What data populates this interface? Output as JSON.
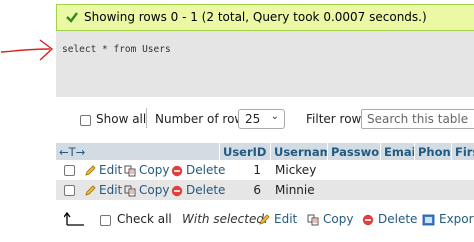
{
  "banner": {
    "message": "Showing rows 0 - 1 (2 total, Query took 0.0007 seconds.)",
    "icon": "check-icon"
  },
  "query": {
    "sql": "select * from Users"
  },
  "controls": {
    "show_all_label": "Show all",
    "num_rows_label": "Number of rows:",
    "num_rows_value": "25",
    "filter_label": "Filter rows:",
    "search_placeholder": "Search this table"
  },
  "table": {
    "headers": {
      "arrows": "←T→",
      "userid": "UserID",
      "username": "Username",
      "password": "Password",
      "email": "Email",
      "phone": "Phone",
      "first": "Firs"
    },
    "row_actions": {
      "edit": "Edit",
      "copy": "Copy",
      "delete": "Delete"
    },
    "rows": [
      {
        "userid": "1",
        "username": "Mickey"
      },
      {
        "userid": "6",
        "username": "Minnie"
      }
    ]
  },
  "bulk": {
    "check_all_label": "Check all",
    "with_selected_label": "With selected:",
    "edit": "Edit",
    "copy": "Copy",
    "delete": "Delete",
    "export": "Export"
  },
  "colors": {
    "success_bg": "#ebf8a4",
    "link": "#235a81",
    "annotation": "#e02020"
  }
}
